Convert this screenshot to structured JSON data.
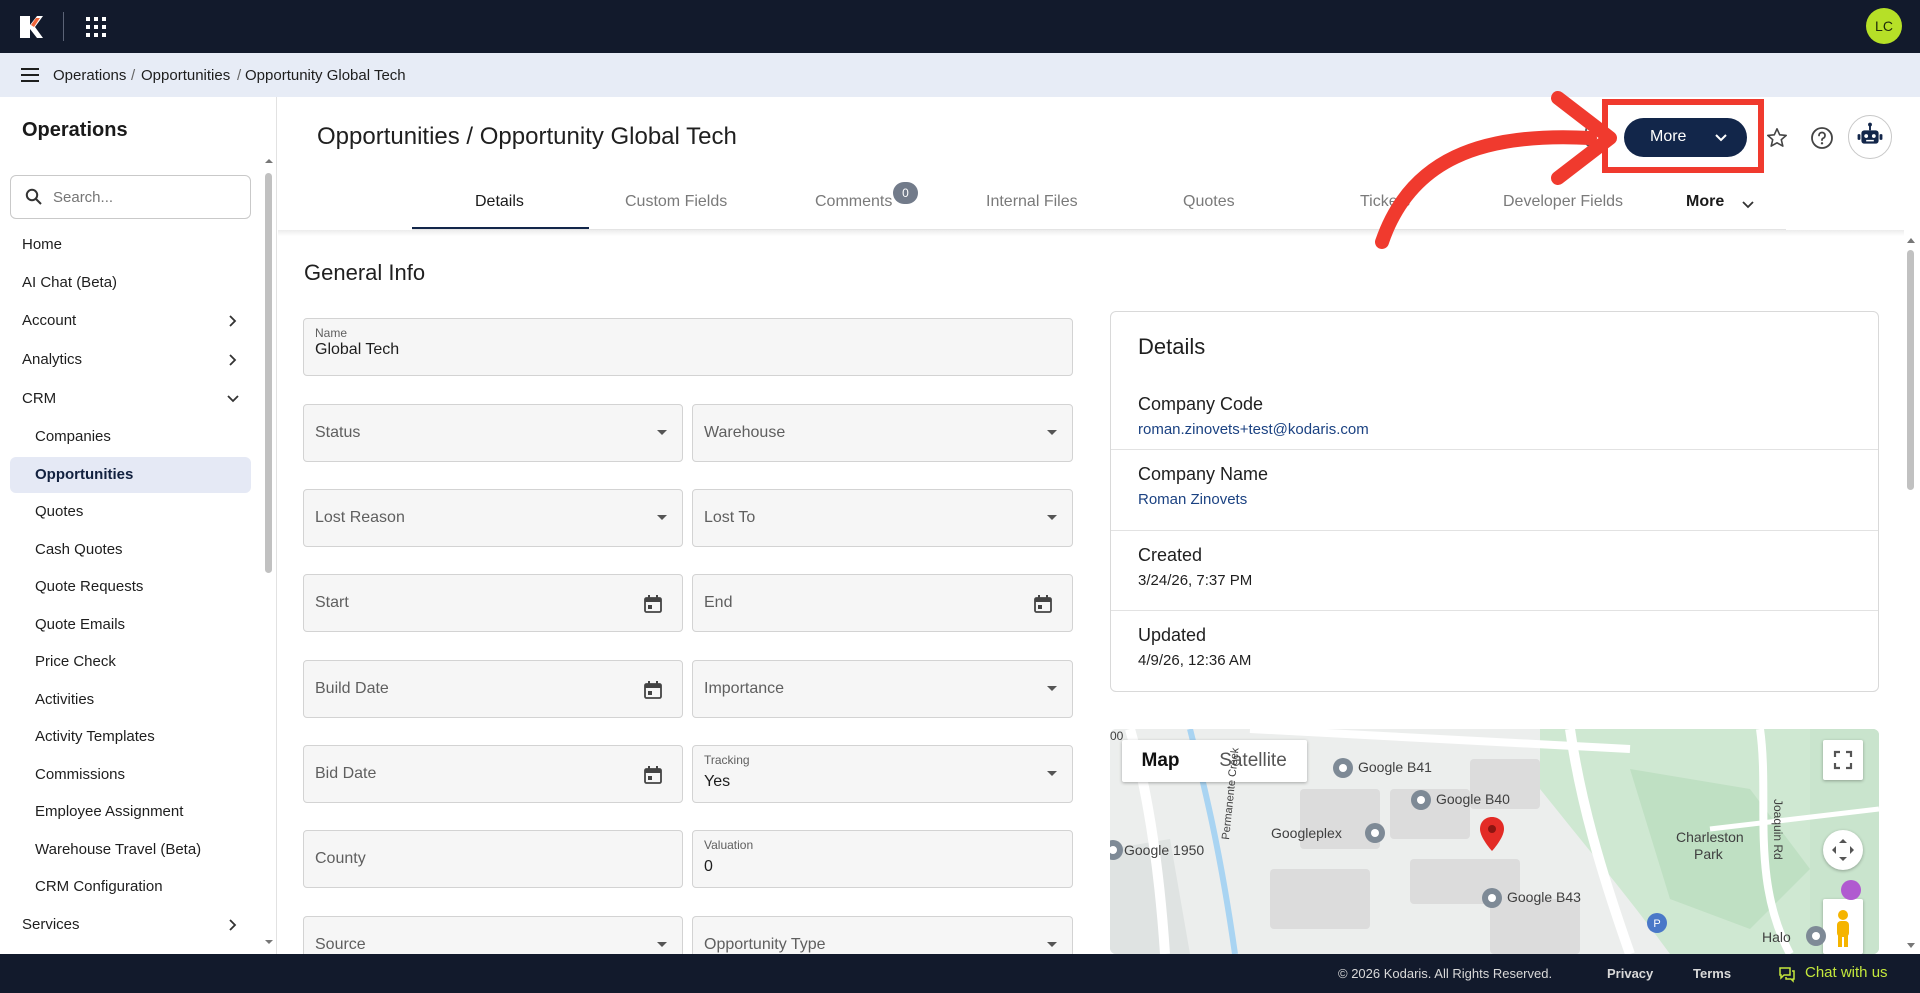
{
  "topbar": {
    "avatar_initials": "LC",
    "logo": "kodaris-logo",
    "apps_icon": "grid-icon",
    "brand_color": "#121a2c",
    "avatar_color": "#b6e027"
  },
  "breadcrumb": {
    "items": [
      "Operations",
      "Opportunities",
      "Opportunity Global Tech"
    ],
    "separator": "/"
  },
  "sidebar": {
    "title": "Operations",
    "search_placeholder": "Search...",
    "items": [
      {
        "label": "Home"
      },
      {
        "label": "AI Chat (Beta)"
      },
      {
        "label": "Account",
        "expandable": true
      },
      {
        "label": "Analytics",
        "expandable": true
      },
      {
        "label": "CRM",
        "expanded": true
      },
      {
        "label": "Companies"
      },
      {
        "label": "Opportunities",
        "active": true
      },
      {
        "label": "Quotes"
      },
      {
        "label": "Cash Quotes"
      },
      {
        "label": "Quote Requests"
      },
      {
        "label": "Quote Emails"
      },
      {
        "label": "Price Check"
      },
      {
        "label": "Activities"
      },
      {
        "label": "Activity Templates"
      },
      {
        "label": "Commissions"
      },
      {
        "label": "Employee Assignment"
      },
      {
        "label": "Warehouse Travel (Beta)"
      },
      {
        "label": "CRM Configuration"
      },
      {
        "label": "Services",
        "expandable": true
      }
    ]
  },
  "header": {
    "title": "Opportunities / Opportunity Global Tech",
    "more_label": "More",
    "accent": "#12264a"
  },
  "tabs": {
    "items": [
      "Details",
      "Custom Fields",
      "Comments",
      "Internal Files",
      "Quotes",
      "Tickets",
      "Developer Fields",
      "More"
    ],
    "active": "Details",
    "comments_count": "0"
  },
  "general_info": {
    "title": "General Info",
    "name_label": "Name",
    "name_value": "Global Tech",
    "status": "Status",
    "warehouse": "Warehouse",
    "lost_reason": "Lost Reason",
    "lost_to": "Lost To",
    "start": "Start",
    "end": "End",
    "build_date": "Build Date",
    "importance": "Importance",
    "bid_date": "Bid Date",
    "tracking_label": "Tracking",
    "tracking_value": "Yes",
    "county": "County",
    "valuation_label": "Valuation",
    "valuation_value": "0",
    "source": "Source",
    "opportunity_type": "Opportunity Type"
  },
  "details_card": {
    "title": "Details",
    "rows": [
      {
        "key": "Company Code",
        "value": "roman.zinovets+test@kodaris.com",
        "link": true
      },
      {
        "key": "Company Name",
        "value": "Roman Zinovets",
        "link": true
      },
      {
        "key": "Created",
        "value": "3/24/26, 7:37 PM"
      },
      {
        "key": "Updated",
        "value": "4/9/26, 12:36 AM"
      }
    ]
  },
  "map": {
    "map_label": "Map",
    "satellite_label": "Satellite",
    "labels": [
      "Google B41",
      "Google B40",
      "Googleplex",
      "Google 1950",
      "Google B43",
      "Charleston",
      "Park",
      "Permanente Creek",
      "Joaquin Rd",
      "Halo",
      "00",
      "P"
    ]
  },
  "footer": {
    "copyright": "© 2026 Kodaris. All Rights Reserved.",
    "privacy": "Privacy",
    "terms": "Terms",
    "chat": "Chat with us",
    "chat_color": "#c4e83c"
  },
  "annotation": {
    "color": "#f03a2e"
  }
}
